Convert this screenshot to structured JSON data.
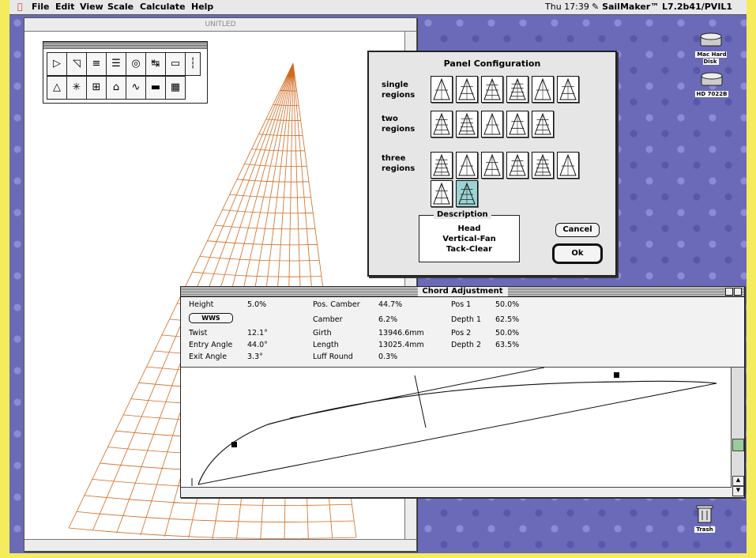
{
  "menubar": {
    "apple": "",
    "items": [
      "File",
      "Edit",
      "View",
      "Scale",
      "Calculate",
      "Help"
    ],
    "clock": "Thu 17:39",
    "app": "SailMaker™ L7.2b41/PVIL1"
  },
  "desktop_icons": [
    {
      "name": "Mac Hard Disk"
    },
    {
      "name": "HD 7022B"
    },
    {
      "name": "Trash"
    }
  ],
  "drawing_window": {
    "title": "UNITLED"
  },
  "panel_config": {
    "title": "Panel Configuration",
    "single_label": "single regions",
    "two_label": "two regions",
    "three_label": "three regions",
    "description_legend": "Description",
    "description_lines": [
      "Head",
      "Vertical-Fan",
      "Tack-Clear"
    ],
    "cancel": "Cancel",
    "ok": "Ok",
    "selected_index": 7
  },
  "chord": {
    "title": "Chord Adjustment",
    "button_label": "WWS",
    "col1": [
      {
        "label": "Height",
        "value": "5.0%"
      },
      {
        "label": "Twist",
        "value": "12.1°"
      },
      {
        "label": "Entry Angle",
        "value": "44.0°"
      },
      {
        "label": "Exit Angle",
        "value": "3.3°"
      }
    ],
    "col2": [
      {
        "label": "Pos. Camber",
        "value": "44.7%"
      },
      {
        "label": "Camber",
        "value": "6.2%"
      },
      {
        "label": "Girth",
        "value": "13946.6mm"
      },
      {
        "label": "Length",
        "value": "13025.4mm"
      },
      {
        "label": "Luff Round",
        "value": "0.3%"
      }
    ],
    "col3": [
      {
        "label": "Pos 1",
        "value": "50.0%"
      },
      {
        "label": "Depth 1",
        "value": "62.5%"
      },
      {
        "label": "Pos 2",
        "value": "50.0%"
      },
      {
        "label": "Depth 2",
        "value": "63.5%"
      }
    ]
  },
  "colors": {
    "sail_mesh": "#d2691e",
    "desktop": "#6a6ab8"
  }
}
